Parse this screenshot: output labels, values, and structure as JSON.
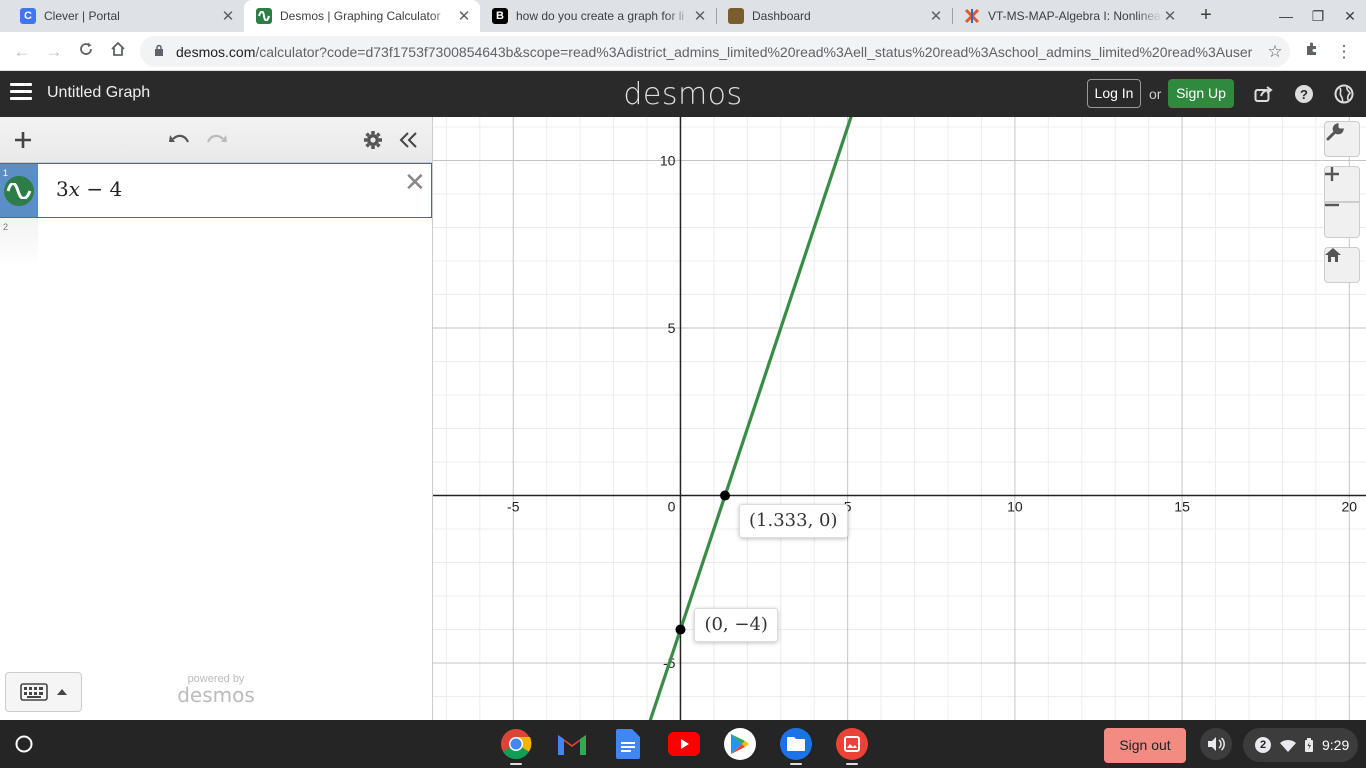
{
  "browser": {
    "tabs": [
      {
        "title": "Clever | Portal",
        "favicon": "clever-icon",
        "color": "#4274f6",
        "active": false
      },
      {
        "title": "Desmos | Graphing Calculator",
        "favicon": "desmos-icon",
        "color": "#2d7d46",
        "active": true
      },
      {
        "title": "how do you create a graph for li",
        "favicon": "brainly-icon",
        "color": "#000000",
        "active": false
      },
      {
        "title": "Dashboard",
        "favicon": "dashboard-icon",
        "color": "#7a5c2e",
        "active": false
      },
      {
        "title": "VT-MS-MAP-Algebra I: Nonlinea",
        "favicon": "nwea-icon",
        "color": "#e8552a",
        "active": false
      }
    ],
    "new_tab": "+",
    "url_domain": "desmos.com",
    "url_rest": "/calculator?code=d73f1753f7300854643b&scope=read%3Adistrict_admins_limited%20read%3Aell_status%20read%3Aschool_admins_limited%20read%3Auser"
  },
  "desmos": {
    "title": "Untitled Graph",
    "logo": "desmos",
    "login": "Log In",
    "or": "or",
    "signup": "Sign Up",
    "accent": "#2f8a3d",
    "expressions": [
      {
        "index": "1",
        "latex_coef": "3",
        "latex_var": "x",
        "latex_rest": " − 4",
        "color": "#2d7d46"
      },
      {
        "index": "2"
      }
    ],
    "powered_by": "powered by",
    "powered_logo": "desmos"
  },
  "chart_data": {
    "type": "line",
    "function": "y = 3x - 4",
    "series": [
      {
        "x": [
          -1,
          0,
          1.333,
          2,
          3,
          4,
          5
        ],
        "y": [
          -7,
          -4,
          0,
          2,
          5,
          8,
          11
        ]
      }
    ],
    "x_ticks": [
      "-5",
      "0",
      "5",
      "10",
      "15",
      "20"
    ],
    "y_ticks": [
      "10",
      "5",
      "-5"
    ],
    "xlim": [
      -7.4,
      20.5
    ],
    "ylim": [
      -6.7,
      11.3
    ],
    "line_color": "#388c46",
    "points": [
      {
        "label": "(1.333, 0)",
        "x": 1.333,
        "y": 0
      },
      {
        "label": "(0, −4)",
        "x": 0,
        "y": -4
      }
    ],
    "grid": true
  },
  "shelf": {
    "signout": "Sign out",
    "notifications": "2",
    "time": "9:29"
  }
}
